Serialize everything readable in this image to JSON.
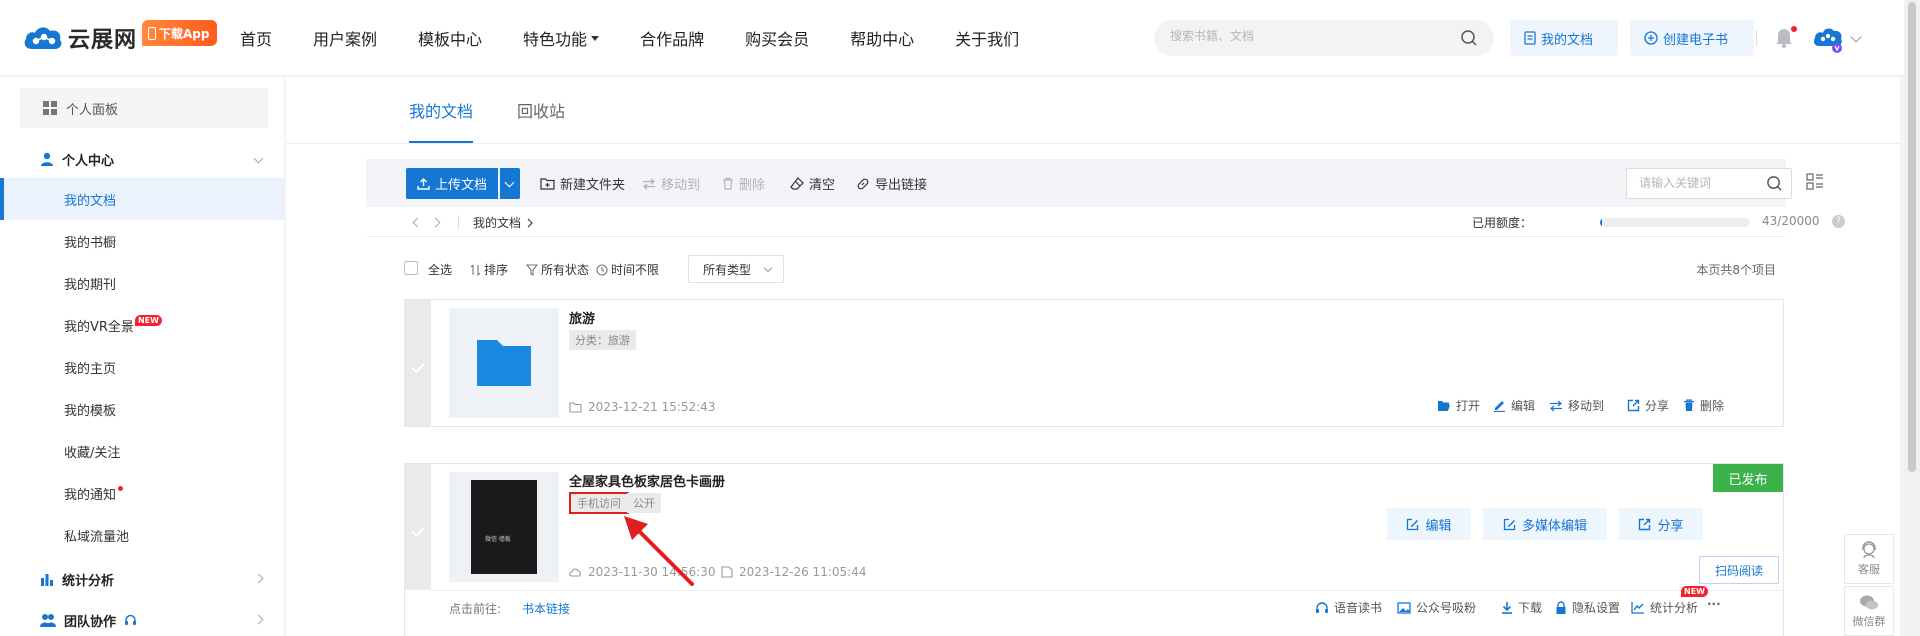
{
  "header": {
    "logo_text": "云展网",
    "app_badge": "下载App",
    "nav": [
      "首页",
      "用户案例",
      "模板中心",
      "特色功能",
      "合作品牌",
      "购买会员",
      "帮助中心",
      "关于我们"
    ],
    "search_placeholder": "搜索书籍、文档",
    "my_docs_btn": "我的文档",
    "create_btn": "创建电子书"
  },
  "sidebar": {
    "panel": "个人面板",
    "group_personal": "个人中心",
    "items": [
      "我的文档",
      "我的书橱",
      "我的期刊",
      "我的VR全景",
      "我的主页",
      "我的模板",
      "收藏/关注",
      "我的通知",
      "私域流量池"
    ],
    "new_badge": "NEW",
    "group_stats": "统计分析",
    "group_team": "团队协作"
  },
  "tabs": [
    "我的文档",
    "回收站"
  ],
  "toolbar": {
    "upload": "上传文档",
    "new_folder": "新建文件夹",
    "move_to": "移动到",
    "delete": "删除",
    "clear": "清空",
    "export_link": "导出链接",
    "keyword_placeholder": "请输入关键词"
  },
  "breadcrumb": {
    "current": "我的文档",
    "quota_label": "已用额度：",
    "quota_value": "43/20000",
    "quota_fraction": 0.00215
  },
  "filters": {
    "select_all": "全选",
    "sort": "排序",
    "all_status": "所有状态",
    "time_unlimited": "时间不限",
    "all_types": "所有类型",
    "page_count": "本页共8个项目"
  },
  "folder_card": {
    "title": "旅游",
    "category_tag": "分类：旅游",
    "date": "2023-12-21 15:52:43",
    "actions": [
      "打开",
      "编辑",
      "移动到",
      "分享",
      "删除"
    ]
  },
  "book_card": {
    "title": "全屋家具色板家居色卡画册",
    "tag_phone": "手机访问",
    "tag_public": "公开",
    "created": "2023-11-30 14:56:30",
    "updated": "2023-12-26 11:05:44",
    "status": "已发布",
    "buttons": [
      "编辑",
      "多媒体编辑",
      "分享"
    ],
    "scan_read": "扫码阅读",
    "goto_label": "点击前往:",
    "goto_link": "书本链接",
    "footer_actions": [
      "语音读书",
      "公众号吸粉",
      "下载",
      "隐私设置",
      "统计分析"
    ],
    "more": "···",
    "new_badge": "NEW",
    "cover_text": "微信·墙板"
  },
  "floating": {
    "service": "客服",
    "wechat_group": "微信群"
  },
  "colors": {
    "primary": "#1677d2",
    "published": "#3cb34a",
    "annotation": "#e02020"
  }
}
